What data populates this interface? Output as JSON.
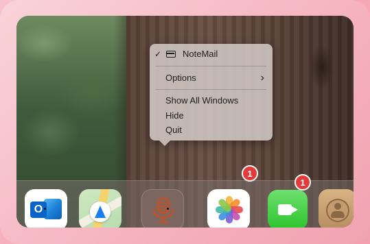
{
  "menu": {
    "app_item": {
      "label": "NoteMail",
      "checked": true,
      "check_glyph": "✓",
      "icon": "window-icon"
    },
    "options_label": "Options",
    "options_arrow": "›",
    "show_all_windows_label": "Show All Windows",
    "hide_label": "Hide",
    "quit_label": "Quit"
  },
  "dock": {
    "apps": [
      {
        "id": "outlook",
        "icon": "outlook-icon",
        "badge": null,
        "running": true,
        "glyph": "O"
      },
      {
        "id": "maps",
        "icon": "maps-icon",
        "badge": null,
        "running": false
      },
      {
        "id": "notemail",
        "icon": "microphone-icon",
        "badge": null,
        "running": true
      },
      {
        "id": "photos",
        "icon": "photos-icon",
        "badge": "1",
        "running": false
      },
      {
        "id": "facetime",
        "icon": "facetime-icon",
        "badge": "1",
        "running": false
      },
      {
        "id": "contacts",
        "icon": "contacts-icon",
        "badge": null,
        "running": false
      }
    ]
  },
  "colors": {
    "badge": "#e63a3a",
    "notemail_icon": "#b9552e",
    "frame": "#f6b3c0"
  }
}
